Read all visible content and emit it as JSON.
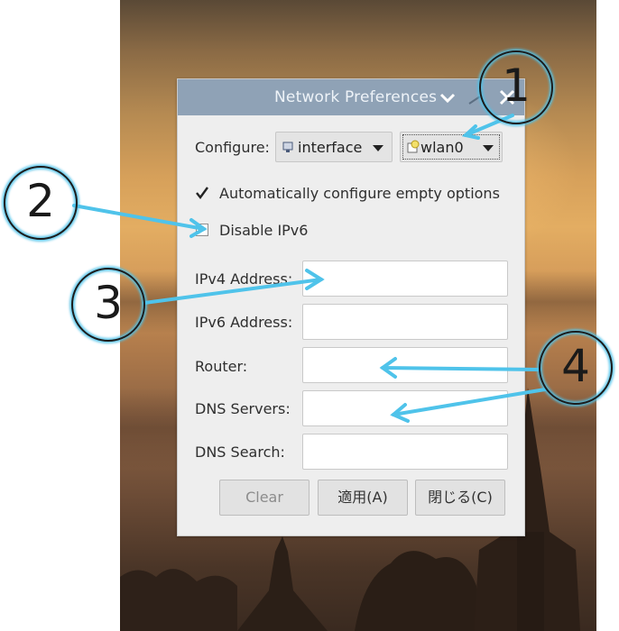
{
  "window": {
    "title": "Network Preferences"
  },
  "configure": {
    "label": "Configure:",
    "type_value": "interface",
    "interface_value": "wlan0"
  },
  "options": {
    "auto_configure_label": "Automatically configure empty options",
    "auto_configure_checked": true,
    "disable_ipv6_label": "Disable IPv6",
    "disable_ipv6_checked": false
  },
  "fields": [
    {
      "label": "IPv4 Address:",
      "value": ""
    },
    {
      "label": "IPv6 Address:",
      "value": ""
    },
    {
      "label": "Router:",
      "value": ""
    },
    {
      "label": "DNS Servers:",
      "value": ""
    },
    {
      "label": "DNS Search:",
      "value": ""
    }
  ],
  "buttons": {
    "clear": "Clear",
    "apply": "適用(A)",
    "close": "閉じる(C)"
  },
  "annotations": {
    "one": "1",
    "two": "2",
    "three": "3",
    "four": "4"
  },
  "colors": {
    "titlebar": "#8fa2b6",
    "dialog_bg": "#eeeeee",
    "arrow": "#4fc3ea"
  }
}
